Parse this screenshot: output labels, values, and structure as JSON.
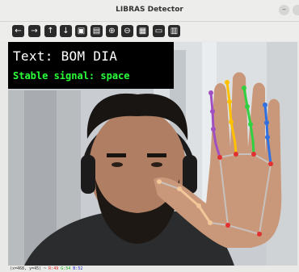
{
  "window": {
    "title": "LIBRAS Detector"
  },
  "toolbar": {
    "icons": [
      "arrow-left",
      "arrow-right",
      "arrow-up",
      "arrow-down",
      "save",
      "save-as",
      "zoom-in",
      "zoom-out",
      "properties",
      "window",
      "copy"
    ]
  },
  "overlay": {
    "text": "Text: BOM DIA",
    "stable": "Stable signal: space"
  },
  "status": {
    "coords": "(x=468, y=45) ~",
    "r": "R:49",
    "g": "G:54",
    "b": "B:52"
  },
  "colors": {
    "overlay_bg": "#000000",
    "text_color": "#ffffff",
    "stable_color": "#2bff3a",
    "landmark_red": "#e03030",
    "thumb": "#f2c79a",
    "index": "#ffc000",
    "middle": "#30d040",
    "ring": "#3070e0",
    "pinky": "#a050c0"
  }
}
